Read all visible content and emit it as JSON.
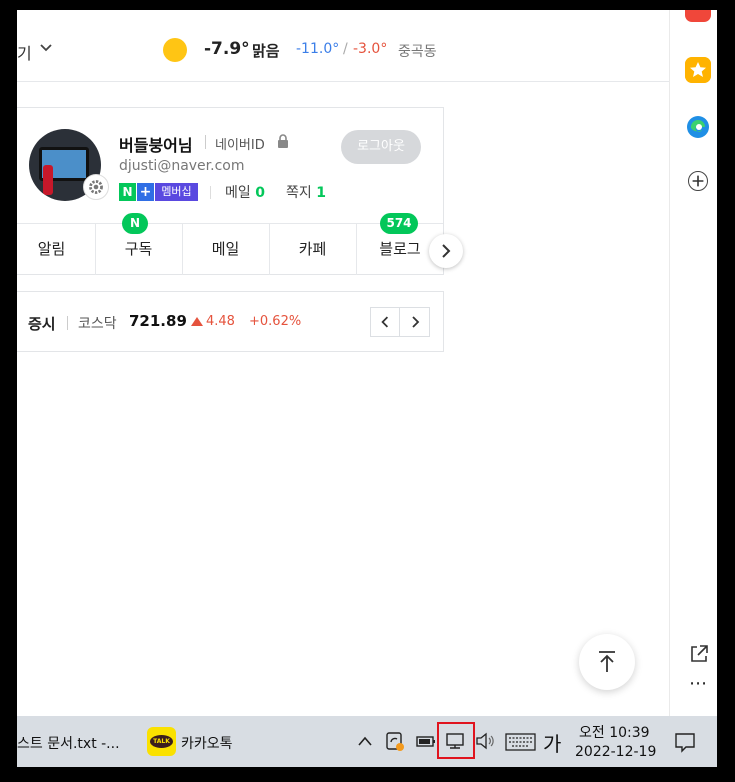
{
  "weather": {
    "cut_text": "기",
    "temp": "-7.9°",
    "condition": "맑음",
    "min": "-11.0°",
    "sep": "/",
    "max": "-3.0°",
    "location": "중곡동"
  },
  "profile": {
    "nickname": "버들붕어님",
    "id_label": "네이버ID",
    "email": "djusti@naver.com",
    "badge_n": "N",
    "badge_plus": "+",
    "badge_membership": "멤버십",
    "mail_label": "메일",
    "mail_count": "0",
    "note_label": "쪽지",
    "note_count": "1",
    "logout_label": "로그아웃"
  },
  "tabs": [
    {
      "label": "알림",
      "badge": ""
    },
    {
      "label": "구독",
      "badge": "N"
    },
    {
      "label": "메일",
      "badge": ""
    },
    {
      "label": "카페",
      "badge": ""
    },
    {
      "label": "블로그",
      "badge": "574"
    }
  ],
  "stock": {
    "category": "증시",
    "index_name": "코스닥",
    "value": "721.89",
    "change": "4.48",
    "percent": "+0.62%"
  },
  "taskbar": {
    "item1": "스트 문서.txt -...",
    "kakao_icon_text": "TALK",
    "item2": "카카오톡",
    "ime": "가",
    "time": "오전 10:39",
    "date": "2022-12-19"
  },
  "icons": {
    "weather": "sun-icon",
    "sidebar": [
      "app-icon-red",
      "star-icon",
      "edge-icon",
      "add-icon",
      "external-link-icon",
      "more-icon"
    ],
    "tray": [
      "chevron-up-icon",
      "sync-icon",
      "battery-icon",
      "network-icon",
      "volume-icon",
      "keyboard-icon",
      "notification-icon"
    ]
  },
  "colors": {
    "naver_green": "#03c75a",
    "down_blue": "#3b7ee8",
    "up_red": "#e5533d",
    "sun": "#ffc514",
    "highlight_box": "#e0141e",
    "taskbar_bg": "#d8dde3"
  }
}
